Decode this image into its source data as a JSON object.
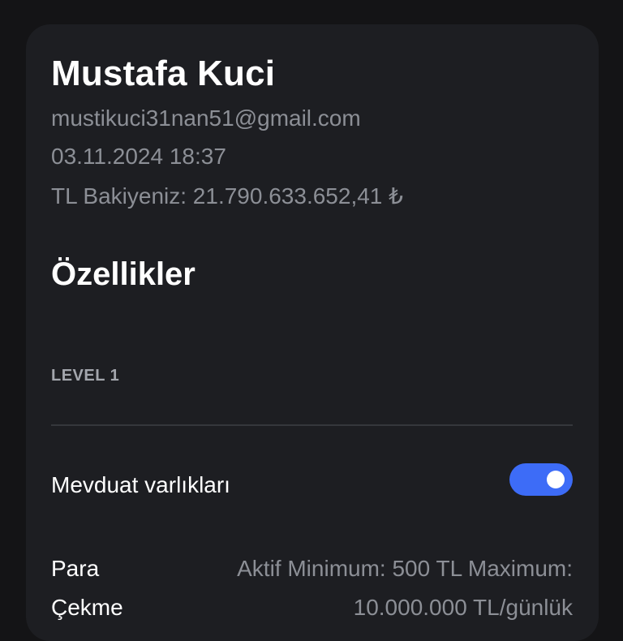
{
  "profile": {
    "name": "Mustafa Kuci",
    "email": "mustikuci31nan51@gmail.com",
    "datetime": "03.11.2024 18:37",
    "balance_label": "TL Bakiyeniz: 21.790.633.652,41 ₺"
  },
  "features": {
    "title": "Özellikler",
    "level": "LEVEL 1",
    "deposit_label": "Mevduat varlıkları",
    "deposit_toggle_on": true,
    "deposit_toggle_color": "#3d6cf7",
    "withdraw_label_line1": "Para",
    "withdraw_label_line2": "Çekme",
    "withdraw_value_line1": "Aktif Minimum: 500 TL Maximum:",
    "withdraw_value_line2": "10.000.000 TL/günlük"
  }
}
